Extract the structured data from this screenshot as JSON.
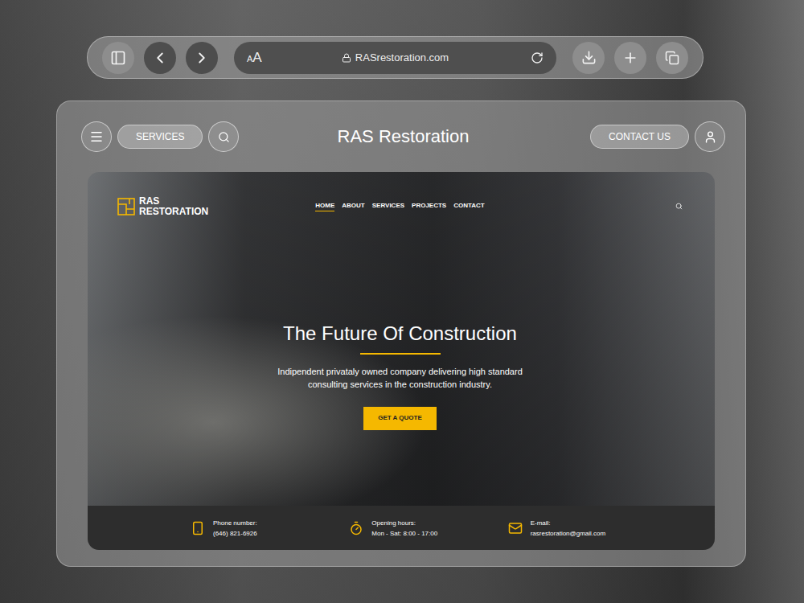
{
  "browser": {
    "text_size_small": "A",
    "text_size_large": "A",
    "url": "RASrestoration.com"
  },
  "app_header": {
    "services_button": "SERVICES",
    "title": "RAS Restoration",
    "contact_button": "CONTACT US"
  },
  "site": {
    "logo": {
      "line1": "RAS",
      "line2": "RESTORATION"
    },
    "nav": [
      {
        "label": "HOME",
        "selected": true
      },
      {
        "label": "ABOUT",
        "selected": false
      },
      {
        "label": "SERVICES",
        "selected": false
      },
      {
        "label": "PROJECTS",
        "selected": false
      },
      {
        "label": "CONTACT",
        "selected": false
      }
    ],
    "hero": {
      "title": "The Future Of Construction",
      "subtitle": "Indipendent privataly owned company delivering high standard consulting services in the construction industry.",
      "button": "GET A QUOTE"
    },
    "info": [
      {
        "kind": "phone",
        "label": "Phone number:",
        "value": "(646) 821-6926"
      },
      {
        "kind": "hours",
        "label": "Opening hours:",
        "value": "Mon - Sat: 8:00 - 17:00"
      },
      {
        "kind": "mail",
        "label": "E-mail:",
        "value": "rasrestoration@gmail.com"
      }
    ]
  }
}
